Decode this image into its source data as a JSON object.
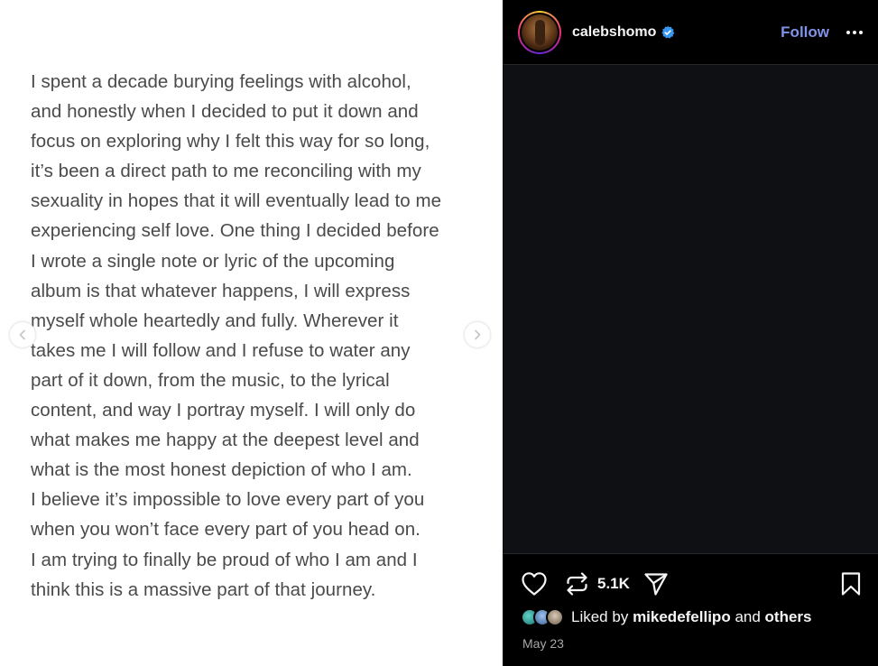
{
  "post_text": {
    "lines": [
      "I spent a decade burying feelings with alcohol,",
      "and honestly when I decided to put it down and",
      "focus on exploring why I felt this way for so long,",
      "it’s been a direct path to me reconciling with my",
      "sexuality in hopes that it will eventually lead to me",
      "experiencing self love. One thing I decided before",
      "I wrote a single note or lyric of the upcoming",
      "album is that whatever happens, I will express",
      "myself whole heartedly and fully. Wherever it",
      "takes me I will follow and I refuse to water any",
      "part of it down, from the music, to the lyrical",
      "content, and way I portray myself. I will only do",
      "what makes me happy at the deepest level and",
      "what is the most honest depiction of who I am.",
      "I believe it’s impossible to love every part of you",
      "when you won’t face every part of you head on.",
      "I am trying to finally be proud of who I am and I",
      "think this is a massive part of that journey."
    ]
  },
  "carousel": {
    "prev_icon": "chevron-left-icon",
    "next_icon": "chevron-right-icon"
  },
  "header": {
    "username": "calebshomo",
    "verified_icon": "verified-badge-icon",
    "follow_label": "Follow",
    "more_icon": "more-options-icon"
  },
  "actions": {
    "like_icon": "heart-icon",
    "repost_icon": "repost-icon",
    "repost_count": "5.1K",
    "share_icon": "send-icon",
    "save_icon": "bookmark-icon"
  },
  "likes": {
    "prefix": "Liked by",
    "user": "mikedefellipo",
    "joiner": "and",
    "others": "others"
  },
  "date": "May 23",
  "colors": {
    "follow": "#7f93e8",
    "verified": "#3897f0",
    "panel_bg": "#0f1014"
  }
}
